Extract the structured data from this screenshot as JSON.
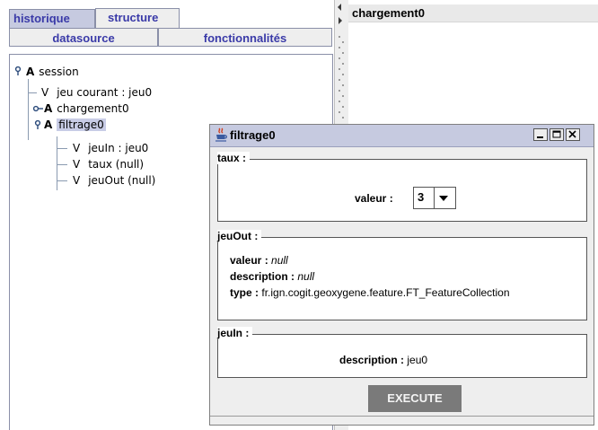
{
  "tabs": {
    "historique": "historique",
    "structure": "structure",
    "datasource": "datasource",
    "fonctionnalites": "fonctionnalités"
  },
  "tree": {
    "session": {
      "kind": "A",
      "label": "session"
    },
    "jeu_courant": {
      "kind": "V",
      "label": "jeu courant : jeu0"
    },
    "chargement": {
      "kind": "A",
      "label": "chargement0"
    },
    "filtrage": {
      "kind": "A",
      "label": "filtrage0"
    },
    "jeuin": {
      "kind": "V",
      "label": "jeuIn : jeu0"
    },
    "taux": {
      "kind": "V",
      "label": "taux (null)"
    },
    "jeuout": {
      "kind": "V",
      "label": "jeuOut (null)"
    }
  },
  "right_header": "chargement0",
  "dialog": {
    "title": "filtrage0",
    "taux": {
      "title": "taux :",
      "valeur_label": "valeur :",
      "valeur_value": "3"
    },
    "jeuout": {
      "title": "jeuOut :",
      "valeur_label": "valeur :",
      "valeur_value": "null",
      "description_label": "description :",
      "description_value": "null",
      "type_label": "type :",
      "type_value": "fr.ign.cogit.geoxygene.feature.FT_FeatureCollection"
    },
    "jeuin": {
      "title": "jeuIn :",
      "description_label": "description :",
      "description_value": "jeu0"
    },
    "execute_label": "EXECUTE"
  },
  "colors": {
    "tab_active": "#c6cae0",
    "tab_text": "#3a3aa8",
    "execute_bg": "#7a7a7a"
  },
  "icons": {
    "tree_key": "key-node-icon",
    "window": "java-cup-icon"
  }
}
